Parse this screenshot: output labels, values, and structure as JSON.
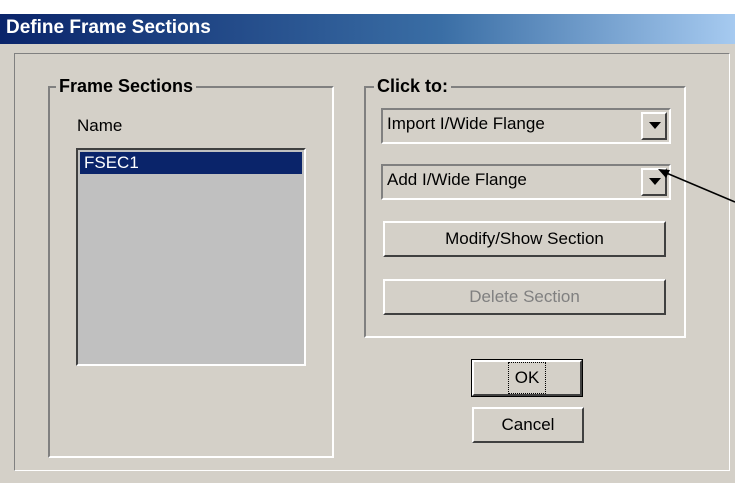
{
  "window": {
    "title": "Define Frame Sections"
  },
  "frame_sections": {
    "group_label": "Frame Sections",
    "name_label": "Name",
    "items": [
      "FSEC1"
    ]
  },
  "click_to": {
    "group_label": "Click to:",
    "import_dropdown": "Import I/Wide Flange",
    "add_dropdown": "Add I/Wide Flange",
    "modify_button": "Modify/Show Section",
    "delete_button": "Delete Section"
  },
  "buttons": {
    "ok": "OK",
    "cancel": "Cancel"
  },
  "icons": {
    "dropdown": "chevron-down-icon"
  }
}
